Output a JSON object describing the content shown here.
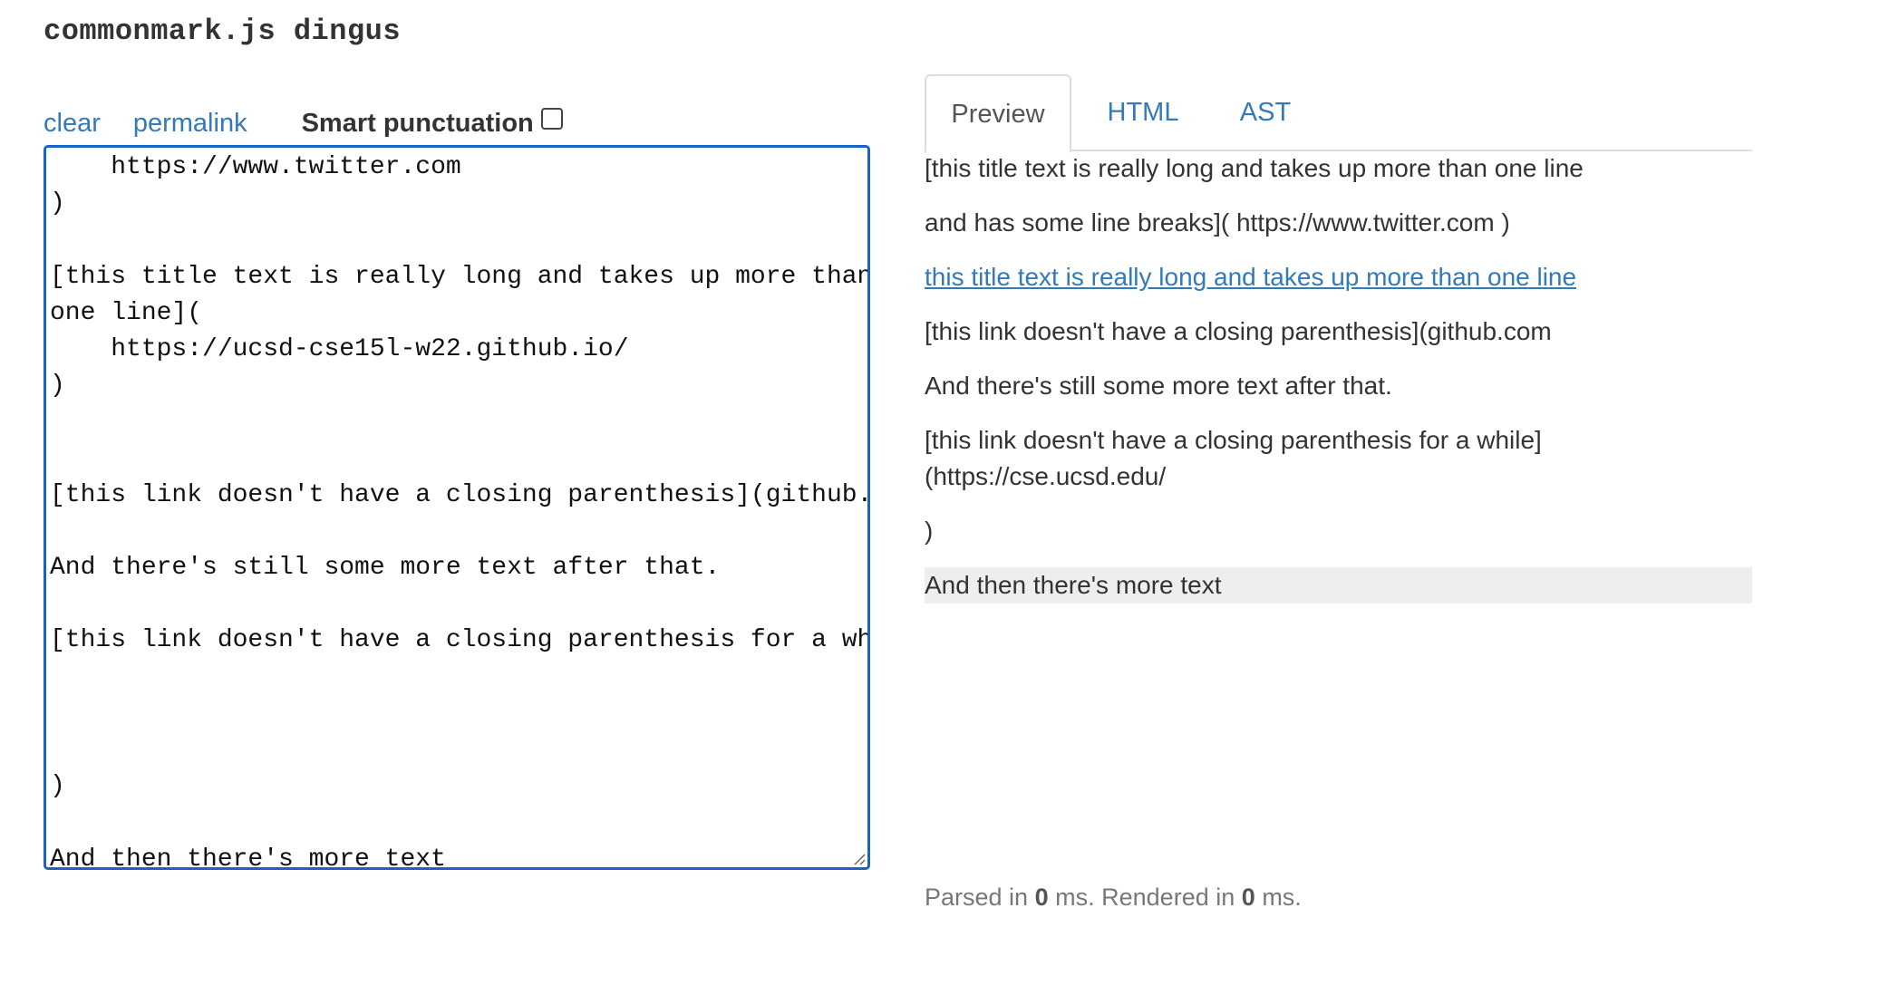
{
  "header": {
    "title": "commonmark.js dingus"
  },
  "controls": {
    "clear": "clear",
    "permalink": "permalink",
    "smart_punctuation": "Smart punctuation"
  },
  "editor": {
    "lines": [
      "    https://www.twitter.com",
      ")",
      "",
      "[this title text is really long and takes up more than",
      "one line](",
      "    https://ucsd-cse15l-w22.github.io/",
      ")",
      "",
      "",
      "[this link doesn't have a closing parenthesis](github.",
      "",
      "And there's still some more text after that.",
      "",
      "[this link doesn't have a closing parenthesis for a wh",
      "",
      "",
      "",
      ")",
      "",
      "And then there's more text"
    ]
  },
  "tabs": {
    "preview": "Preview",
    "html": "HTML",
    "ast": "AST"
  },
  "preview": {
    "p1": "[this title text is really long and takes up more than one line",
    "p2": "and has some line breaks]( https://www.twitter.com )",
    "p3": "this title text is really long and takes up more than one line",
    "p4": "[this link doesn't have a closing parenthesis](github.com",
    "p5": "And there's still some more text after that.",
    "p6a": "[this link doesn't have a closing parenthesis for a while]",
    "p6b": "(https://cse.ucsd.edu/",
    "p7": ")",
    "p8": "And then there's more text"
  },
  "timing": {
    "parsed_label": "Parsed in",
    "parsed_value": "0",
    "rendered_label": "ms. Rendered in",
    "rendered_value": "0",
    "suffix": "ms."
  },
  "colors": {
    "link": "#337ab7",
    "editor_border": "#1a62c4",
    "selected_block_bg": "#eeeeee",
    "muted_text": "#777777"
  }
}
